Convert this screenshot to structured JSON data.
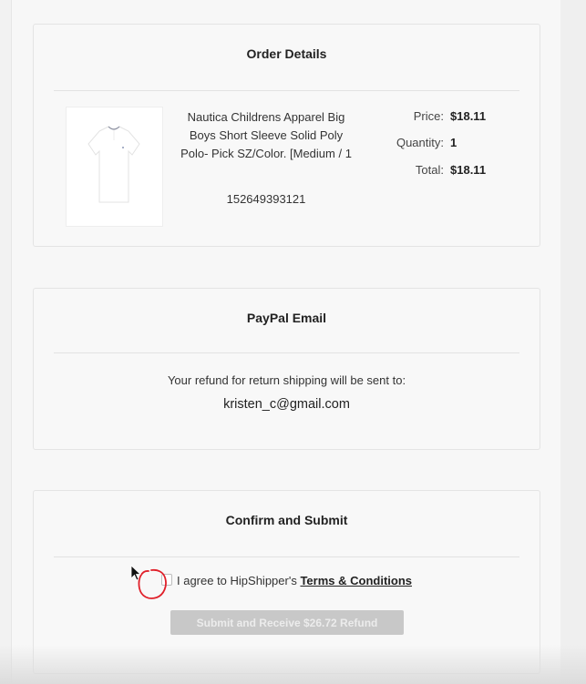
{
  "order_details": {
    "title": "Order Details",
    "product": {
      "name": "Nautica Childrens Apparel Big Boys Short Sleeve Solid Poly Polo- Pick SZ/Color. [Medium / 1",
      "item_id": "152649393121"
    },
    "price_label": "Price:",
    "price_value": "$18.11",
    "quantity_label": "Quantity:",
    "quantity_value": "1",
    "total_label": "Total:",
    "total_value": "$18.11"
  },
  "paypal_email": {
    "title": "PayPal Email",
    "refund_text": "Your refund for return shipping will be sent to:",
    "email": "kristen_c@gmail.com"
  },
  "confirm": {
    "title": "Confirm and Submit",
    "agree_text": "I agree to HipShipper's",
    "terms_link": "Terms & Conditions",
    "submit_label": "Submit and Receive $26.72 Refund",
    "checkbox_checked": false,
    "submit_disabled": true
  },
  "colors": {
    "annotation_circle": "#e0202a",
    "button_disabled": "#c8c8c8"
  }
}
